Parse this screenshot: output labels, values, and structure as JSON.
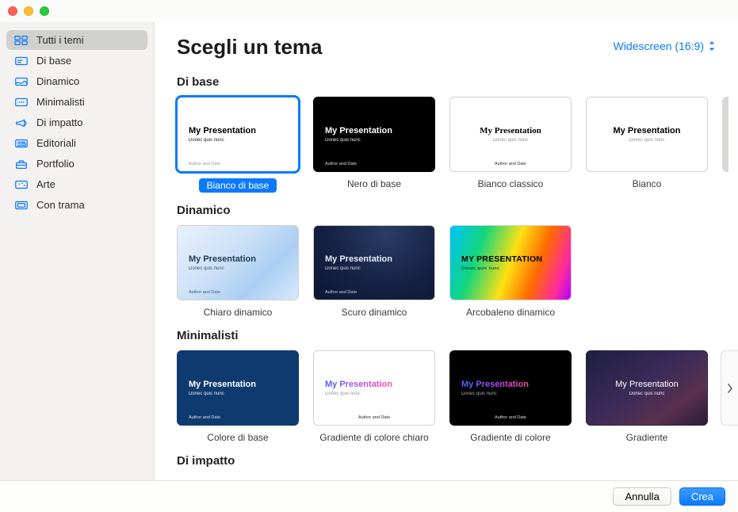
{
  "sidebar": {
    "items": [
      {
        "id": "all",
        "label": "Tutti i temi",
        "icon": "grid",
        "selected": true
      },
      {
        "id": "basic",
        "label": "Di base",
        "icon": "slide",
        "selected": false
      },
      {
        "id": "dynamic",
        "label": "Dinamico",
        "icon": "waves",
        "selected": false
      },
      {
        "id": "minimal",
        "label": "Minimalisti",
        "icon": "dots",
        "selected": false
      },
      {
        "id": "impact",
        "label": "Di impatto",
        "icon": "megaphone",
        "selected": false
      },
      {
        "id": "editorial",
        "label": "Editoriali",
        "icon": "newspaper",
        "selected": false
      },
      {
        "id": "portfolio",
        "label": "Portfolio",
        "icon": "briefcase",
        "selected": false
      },
      {
        "id": "art",
        "label": "Arte",
        "icon": "palette",
        "selected": false
      },
      {
        "id": "texture",
        "label": "Con trama",
        "icon": "frame",
        "selected": false
      }
    ]
  },
  "header": {
    "title": "Scegli un tema",
    "aspect_label": "Widescreen (16:9)"
  },
  "thumb_text": {
    "title": "My Presentation",
    "title_upper": "MY PRESENTATION",
    "sub": "Donec quis nunc",
    "foot": "Author and Date"
  },
  "sections": [
    {
      "title": "Di base",
      "peek": true,
      "arrow": false,
      "themes": [
        {
          "label": "Bianco di base",
          "klass": "bg-white",
          "selected": true,
          "foot": "left",
          "titleKey": "title"
        },
        {
          "label": "Nero di base",
          "klass": "bg-black",
          "selected": false,
          "foot": "left",
          "titleKey": "title"
        },
        {
          "label": "Bianco classico",
          "klass": "bg-classic-white",
          "selected": false,
          "foot": "center",
          "titleKey": "title",
          "centered": true
        },
        {
          "label": "Bianco",
          "klass": "bg-plain-white",
          "selected": false,
          "foot": "none",
          "titleKey": "title",
          "centered": true
        }
      ]
    },
    {
      "title": "Dinamico",
      "peek": false,
      "arrow": false,
      "themes": [
        {
          "label": "Chiaro dinamico",
          "klass": "bg-dyn-light",
          "selected": false,
          "foot": "left",
          "titleKey": "title"
        },
        {
          "label": "Scuro dinamico",
          "klass": "bg-dyn-dark",
          "selected": false,
          "foot": "left",
          "titleKey": "title"
        },
        {
          "label": "Arcobaleno dinamico",
          "klass": "bg-dyn-rainbow",
          "selected": false,
          "foot": "none",
          "titleKey": "title_upper"
        }
      ]
    },
    {
      "title": "Minimalisti",
      "peek": false,
      "arrow": true,
      "themes": [
        {
          "label": "Colore di base",
          "klass": "bg-solid-navy",
          "selected": false,
          "foot": "left",
          "titleKey": "title"
        },
        {
          "label": "Gradiente di colore chiaro",
          "klass": "bg-grad-light",
          "selected": false,
          "foot": "center",
          "titleKey": "title"
        },
        {
          "label": "Gradiente di colore",
          "klass": "bg-grad-dark",
          "selected": false,
          "foot": "center",
          "titleKey": "title"
        },
        {
          "label": "Gradiente",
          "klass": "bg-gradient",
          "selected": false,
          "foot": "none",
          "titleKey": "title",
          "centered": true
        }
      ]
    },
    {
      "title": "Di impatto",
      "peek": false,
      "arrow": false,
      "themes": []
    }
  ],
  "footer": {
    "cancel_label": "Annulla",
    "create_label": "Crea"
  }
}
